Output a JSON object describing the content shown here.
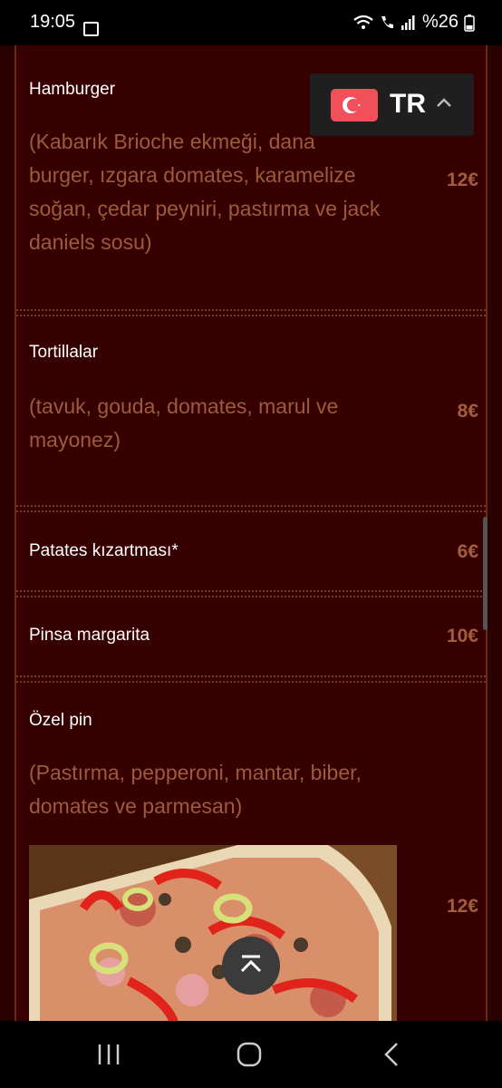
{
  "status": {
    "time": "19:05",
    "battery": "%26"
  },
  "language": {
    "code": "TR",
    "flag_icon": "turkey-flag-icon"
  },
  "menu_items": [
    {
      "name": "Hamburger",
      "description": "(Kabarık Brioche ekmeği, dana burger, ızgara domates, karamelize soğan, çedar peyniri, pastırma ve jack daniels sosu)",
      "price": "12€"
    },
    {
      "name": "Tortillalar",
      "description": "(tavuk, gouda, domates, marul ve mayonez)",
      "price": "8€"
    },
    {
      "name": "Patates kızartması*",
      "description": "",
      "price": "6€"
    },
    {
      "name": "Pinsa margarita",
      "description": "",
      "price": "10€"
    },
    {
      "name": "Özel pin",
      "description": "(Pastırma, pepperoni, mantar, biber, domates ve parmesan)",
      "price": "12€"
    }
  ],
  "colors": {
    "background": "#2b0000",
    "panel": "#370000",
    "text_accent": "#9d5b3c",
    "price": "#a45d3e"
  }
}
